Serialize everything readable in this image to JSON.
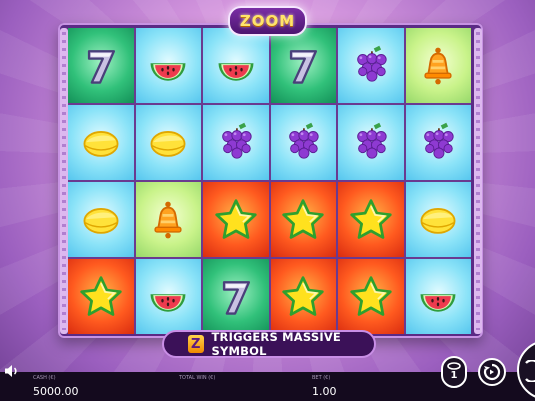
{
  "game": {
    "logo_text": "ZOOM",
    "tip_icon": "Z",
    "tip_text": "TRIGGERS MASSIVE SYMBOL"
  },
  "grid": {
    "rows": [
      [
        "seven",
        "watermelon",
        "watermelon",
        "seven",
        "grapes",
        "bell"
      ],
      [
        "lemon",
        "lemon",
        "grapes",
        "grapes",
        "grapes",
        "grapes"
      ],
      [
        "lemon",
        "bell",
        "star",
        "star",
        "star",
        "lemon"
      ],
      [
        "star",
        "watermelon",
        "seven",
        "star",
        "star",
        "watermelon"
      ]
    ],
    "backgrounds": [
      [
        "green",
        "blue",
        "blue",
        "green",
        "blue",
        "lime"
      ],
      [
        "blue",
        "blue",
        "blue",
        "blue",
        "blue",
        "blue"
      ],
      [
        "blue",
        "lime",
        "red",
        "red",
        "red",
        "blue"
      ],
      [
        "red",
        "blue",
        "green",
        "red",
        "red",
        "blue"
      ]
    ]
  },
  "bottom_bar": {
    "cash_label": "CASH (€)",
    "cash_value": "5000.00",
    "total_win_label": "TOTAL WIN (€)",
    "total_win_value": "",
    "bet_label": "BET (€)",
    "bet_value": "1.00"
  },
  "controls": {
    "sound_icon": "speaker-icon",
    "bet_chip_icon": "coin-stack-icon",
    "autoplay_icon": "autoplay-icon",
    "spin_icon": "spin-icon"
  },
  "colors": {
    "frame": "#5b2a85",
    "logo_text": "#ffe46a",
    "bottom_bar": "#140a1e"
  }
}
